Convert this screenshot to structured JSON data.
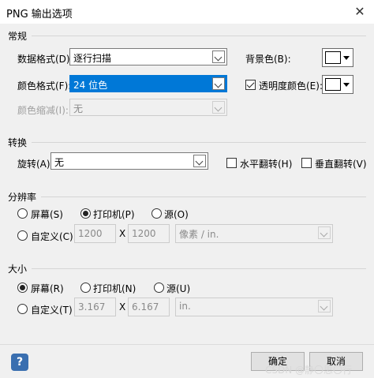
{
  "window": {
    "title": "PNG 输出选项"
  },
  "general": {
    "section_title": "常规",
    "data_format_label": "数据格式(D):",
    "data_format_value": "逐行扫描",
    "color_format_label": "颜色格式(F):",
    "color_format_value": "24 位色",
    "compression_label": "颜色缩减(I):",
    "compression_value": "无",
    "background_label": "背景色(B):",
    "transparency_label": "透明度颜色(E):",
    "transparency_checked": true
  },
  "transform": {
    "section_title": "转换",
    "rotate_label": "旋转(A):",
    "rotate_value": "无",
    "flip_h_label": "水平翻转(H)",
    "flip_v_label": "垂直翻转(V)"
  },
  "resolution": {
    "section_title": "分辨率",
    "screen_label": "屏幕(S)",
    "printer_label": "打印机(P)",
    "source_label": "源(O)",
    "custom_label": "自定义(C)",
    "selected": "printer",
    "x_value": "1200",
    "y_value": "1200",
    "x_sep": "X",
    "unit_value": "像素 / in."
  },
  "size": {
    "section_title": "大小",
    "screen_label": "屏幕(R)",
    "printer_label": "打印机(N)",
    "source_label": "源(U)",
    "custom_label": "自定义(T)",
    "selected": "screen",
    "w_value": "3.167",
    "h_value": "6.167",
    "x_sep": "X",
    "unit_value": "in."
  },
  "footer": {
    "help_glyph": "?",
    "ok_label": "确定",
    "cancel_label": "取消",
    "watermark": "CSDN @静〇思〇行"
  }
}
